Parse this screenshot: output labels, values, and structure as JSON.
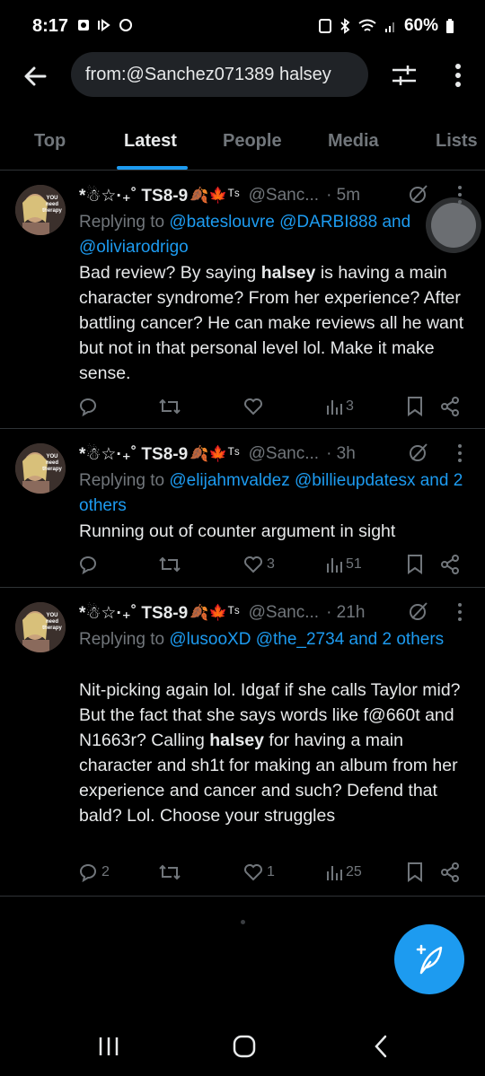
{
  "status_bar": {
    "time": "8:17",
    "battery": "60%"
  },
  "search": {
    "query": "from:@Sanchez071389 halsey"
  },
  "tabs": [
    {
      "label": "Top"
    },
    {
      "label": "Latest"
    },
    {
      "label": "People"
    },
    {
      "label": "Media"
    },
    {
      "label": "Lists"
    }
  ],
  "avatar_text": "YOU need therapy",
  "tweets": [
    {
      "display_name": "*☃☆·₊˚ TS8-9",
      "emojis": "🍂🍁ᵀˢ",
      "handle": "@Sanc...",
      "time": "· 5m",
      "replying_prefix": "Replying to",
      "replying_to": "@bateslouvre @DARBI888 and @oliviarodrigo",
      "body_before": "Bad review? By saying ",
      "body_bold": "halsey",
      "body_after": " is having a main character syndrome? From her experience? After battling cancer? He can make reviews all he want but not in that personal level lol. Make it make sense.",
      "replies": "",
      "retweets": "",
      "likes": "",
      "views": "3"
    },
    {
      "display_name": "*☃☆·₊˚ TS8-9",
      "emojis": "🍂🍁ᵀˢ",
      "handle": "@Sanc...",
      "time": "· 3h",
      "replying_prefix": "Replying to",
      "replying_to": "@elijahmvaldez @billieupdatesx and 2 others",
      "body_before": "Running out of counter argument in sight",
      "body_bold": "",
      "body_after": "",
      "replies": "",
      "retweets": "",
      "likes": "3",
      "views": "51"
    },
    {
      "display_name": "*☃☆·₊˚ TS8-9",
      "emojis": "🍂🍁ᵀˢ",
      "handle": "@Sanc...",
      "time": "· 21h",
      "replying_prefix": "Replying to",
      "replying_to": "@lusooXD @the_2734 and 2 others",
      "body_before": "Nit-picking again lol. Idgaf if she calls Taylor mid? But the fact that she says words like f@660t and N1663r? Calling ",
      "body_bold": "halsey",
      "body_after": " for having a main character and sh1t for making an album from her experience and cancer and such? Defend that bald? Lol. Choose your struggles",
      "replies": "2",
      "retweets": "",
      "likes": "1",
      "views": "25"
    }
  ],
  "colors": {
    "accent": "#1d9bf0",
    "muted": "#71767b",
    "text": "#e7e9ea",
    "divider": "#2f3336",
    "search_bg": "#202327"
  },
  "icons": [
    "back-arrow-icon",
    "filter-icon",
    "more-vertical-icon",
    "grok-icon",
    "reply-icon",
    "retweet-icon",
    "like-icon",
    "views-icon",
    "bookmark-icon",
    "share-icon",
    "compose-icon"
  ]
}
